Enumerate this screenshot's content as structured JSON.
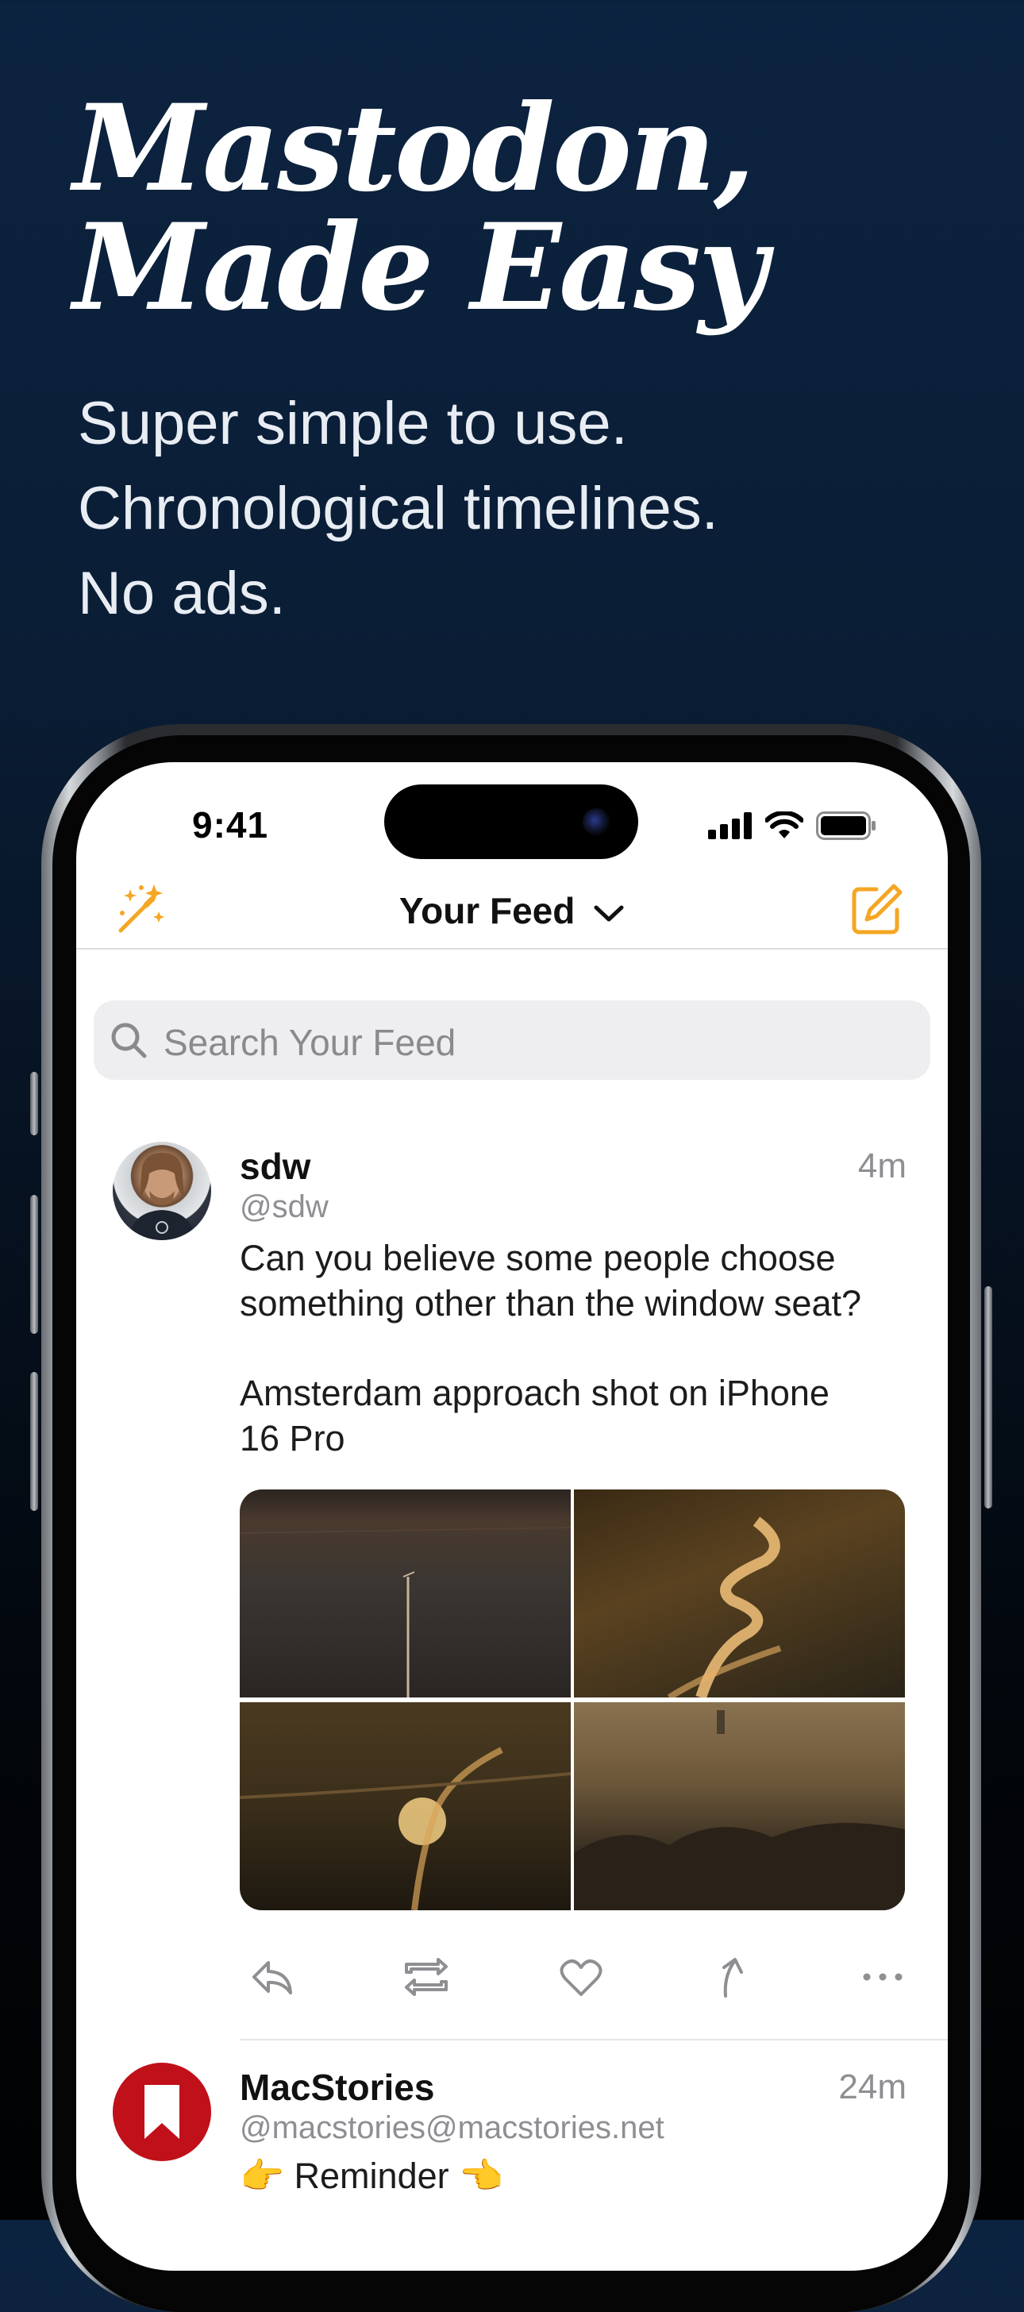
{
  "marketing": {
    "headline": [
      "Mastodon,",
      "Made Easy"
    ],
    "subhead": [
      "Super simple to use.",
      "Chronological timelines.",
      "No ads."
    ]
  },
  "status_bar": {
    "time": "9:41",
    "icons": [
      "cellular-signal-icon",
      "wifi-icon",
      "battery-icon"
    ]
  },
  "nav": {
    "title": "Your Feed",
    "left_icon": "magic-wand-icon",
    "right_icon": "compose-icon",
    "accent": "#f5a623"
  },
  "search": {
    "placeholder": "Search Your Feed",
    "icon": "search-icon"
  },
  "posts": [
    {
      "name": "sdw",
      "handle": "@sdw",
      "time": "4m",
      "text_lines": [
        "Can you believe some people choose",
        "something other than the window seat?"
      ],
      "text_lines_2": [
        "Amsterdam approach shot on iPhone",
        "16 Pro"
      ],
      "media_count": 4,
      "actions": [
        "reply-icon",
        "boost-icon",
        "favorite-icon",
        "share-icon",
        "more-icon"
      ]
    },
    {
      "name": "MacStories",
      "handle": "@macstories@macstories.net",
      "time": "24m",
      "text": "👉 Reminder 👈",
      "avatar_color": "#c0101a"
    }
  ]
}
